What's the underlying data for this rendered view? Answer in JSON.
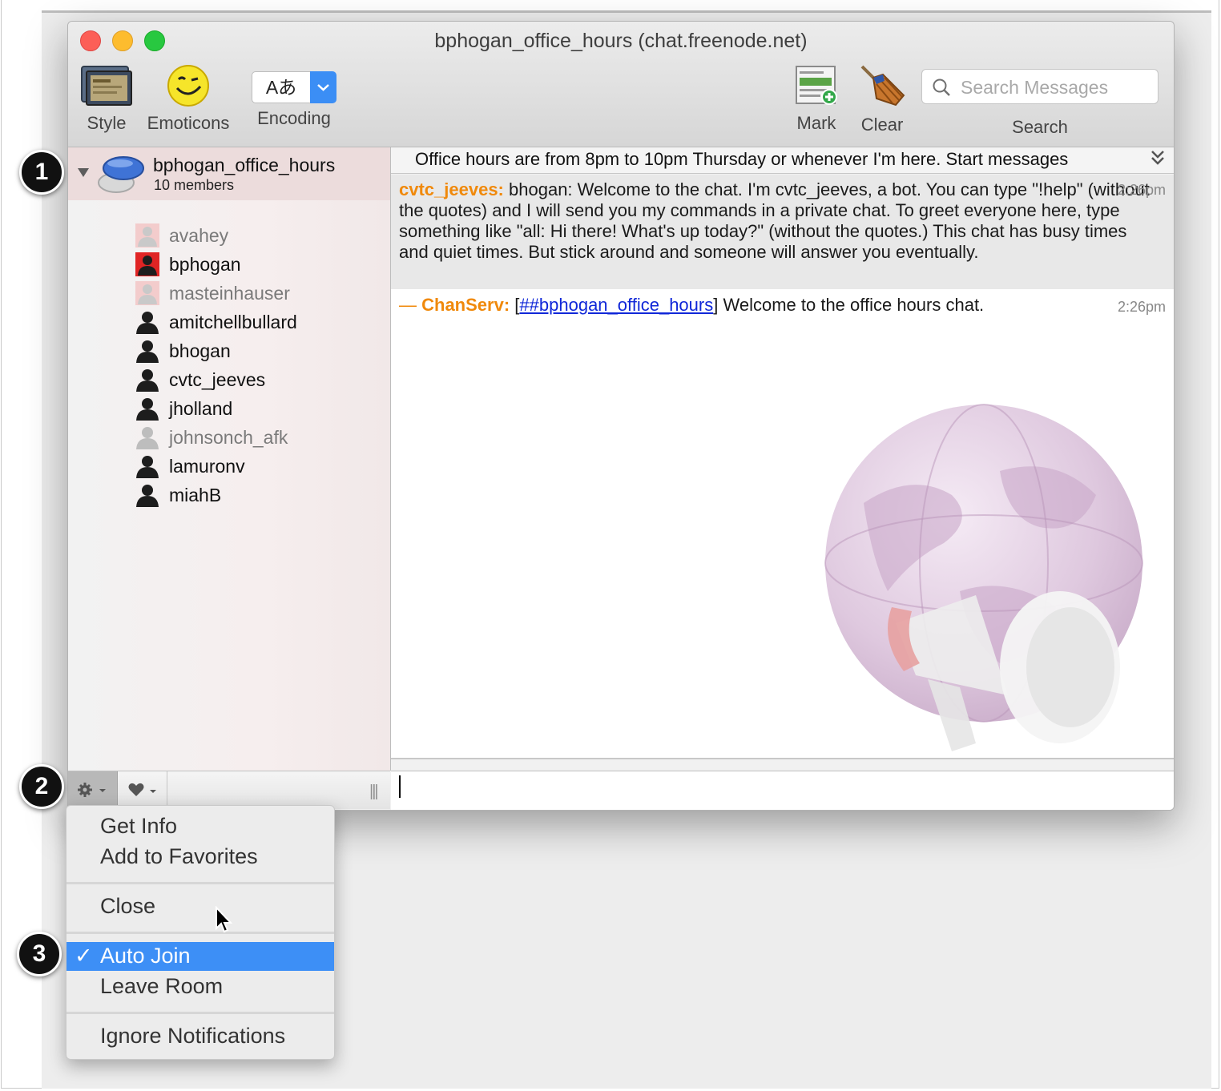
{
  "window": {
    "title": "bphogan_office_hours (chat.freenode.net)"
  },
  "toolbar": {
    "style_label": "Style",
    "emoticons_label": "Emoticons",
    "encoding_label": "Encoding",
    "encoding_glyph": "Aあ",
    "mark_label": "Mark",
    "clear_label": "Clear",
    "search_label": "Search",
    "search_placeholder": "Search Messages",
    "search_value": ""
  },
  "sidebar": {
    "room_name": "bphogan_office_hours",
    "room_members": "10 members",
    "members": [
      {
        "name": "avahey",
        "status": "idle-op"
      },
      {
        "name": "bphogan",
        "status": "op"
      },
      {
        "name": "masteinhauser",
        "status": "idle-op"
      },
      {
        "name": "amitchellbullard",
        "status": "active"
      },
      {
        "name": "bhogan",
        "status": "active"
      },
      {
        "name": "cvtc_jeeves",
        "status": "active"
      },
      {
        "name": "jholland",
        "status": "active"
      },
      {
        "name": "johnsonch_afk",
        "status": "idle"
      },
      {
        "name": "lamuronv",
        "status": "active"
      },
      {
        "name": "miahB",
        "status": "active"
      }
    ]
  },
  "chat": {
    "topic": "Office hours are from 8pm to 10pm Thursday or whenever I'm here. Start messages",
    "messages": [
      {
        "nick": "cvtc_jeeves:",
        "text": "bhogan: Welcome to the chat. I'm cvtc_jeeves, a bot. You can type \"!help\" (without the quotes) and I will send you my commands in a private chat. To greet everyone here, type something like \"all: Hi there! What's up today?\" (without the quotes.) This chat has busy times and quiet times. But stick around and someone will answer you eventually.",
        "time": "2:26pm"
      },
      {
        "prefix": "—",
        "nick": "ChanServ:",
        "bracket_open": "[",
        "channel": "##bphogan_office_hours",
        "bracket_close": "]",
        "text": " Welcome to the office hours chat.",
        "time": "2:26pm"
      }
    ],
    "input_value": ""
  },
  "menu": {
    "items": [
      {
        "label": "Get Info"
      },
      {
        "label": "Add to Favorites"
      },
      {
        "label": "Close"
      },
      {
        "label": "Auto Join",
        "checked": true,
        "check": "✓"
      },
      {
        "label": "Leave Room"
      },
      {
        "label": "Ignore Notifications"
      }
    ]
  },
  "callouts": [
    "1",
    "2",
    "3"
  ],
  "colors": {
    "nick": "#f0890b",
    "link": "#1027d8",
    "menu_highlight": "#3d8ff6",
    "close": "#fc5f57",
    "minimize": "#fdbc2e",
    "maximize": "#28c840"
  }
}
